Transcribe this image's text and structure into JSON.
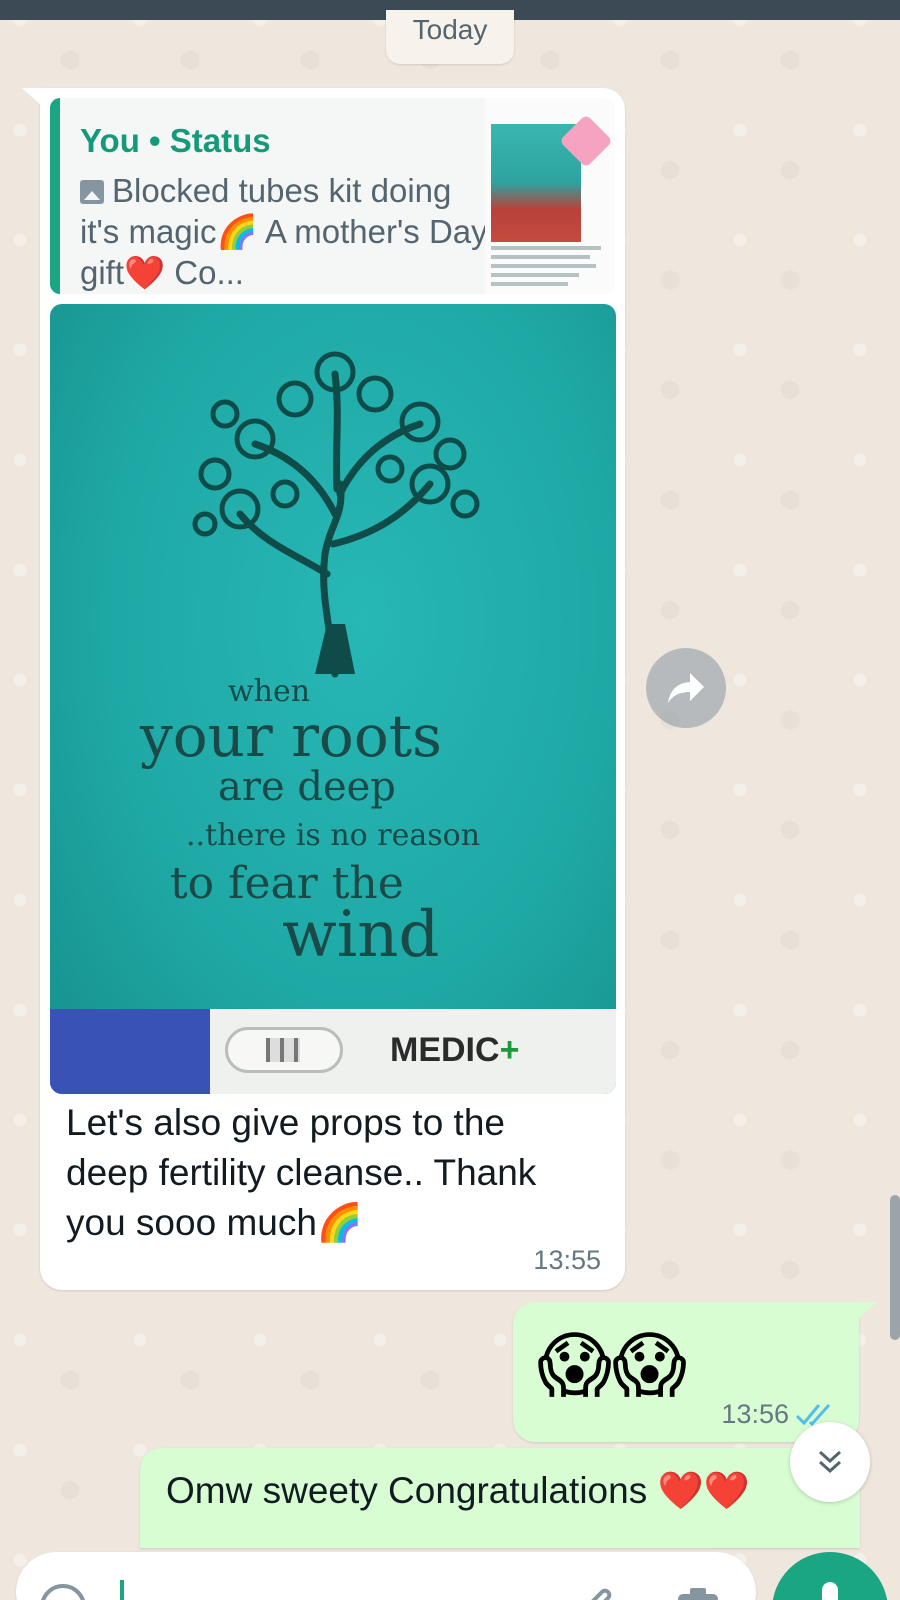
{
  "date_separator": "Today",
  "incoming_message": {
    "quote": {
      "title": "You • Status",
      "text": "Blocked tubes kit doing it's magic🌈 A mother's Day gift❤️ Co..."
    },
    "photo": {
      "lines": [
        "when",
        "your roots",
        "are deep",
        "..there is no reason",
        "to fear the",
        "wind"
      ],
      "brand": "MEDIC",
      "brand_plus": "+"
    },
    "text": "Let's also give props to the deep fertility cleanse.. Thank you sooo much🌈",
    "time": "13:55"
  },
  "outgoing_message": {
    "text": "😱😱",
    "time": "13:56"
  },
  "outgoing_message_2": {
    "text": "Omw sweety Congratulations ",
    "hearts": "❤️❤️"
  },
  "composer": {
    "placeholder": ""
  },
  "colors": {
    "accent": "#1aa583",
    "incoming_bubble": "#ffffff",
    "outgoing_bubble": "#d9fdd3",
    "wallpaper": "#efe7dd",
    "read_ticks": "#53bdeb"
  },
  "icons": [
    "forward-icon",
    "read-ticks-icon",
    "chevron-double-down-icon",
    "emoji-icon",
    "attach-icon",
    "camera-icon",
    "mic-icon",
    "photo-icon"
  ]
}
